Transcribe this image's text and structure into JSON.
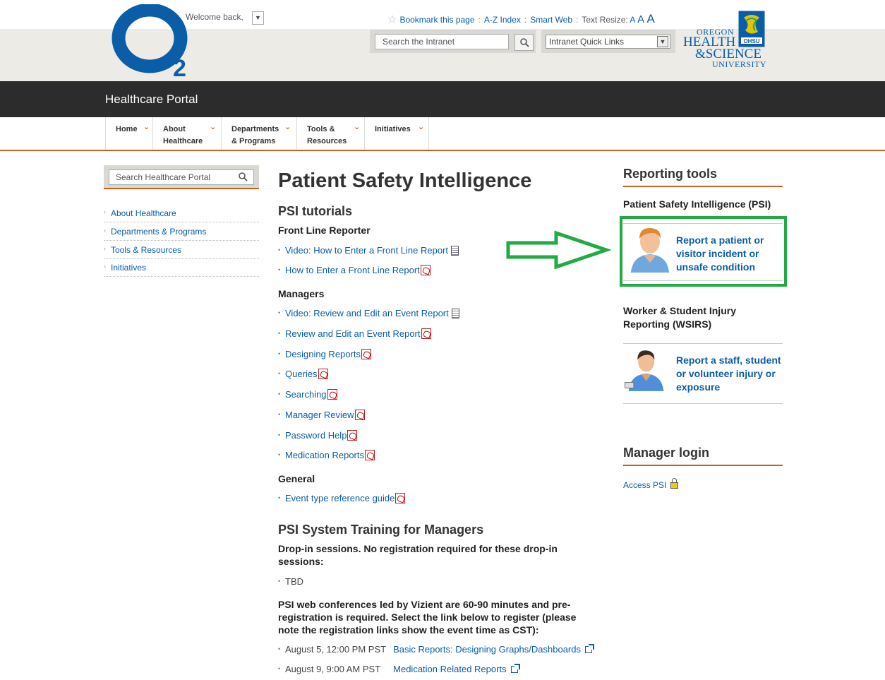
{
  "header": {
    "logo_text": "O",
    "logo_sub": "2",
    "welcome": "Welcome back,",
    "toplinks": {
      "bookmark": "Bookmark this page",
      "az": "A-Z Index",
      "smartweb": "Smart Web",
      "text_resize": "Text Resize:",
      "a_small": "A",
      "a_medium": "A",
      "a_large": "A"
    },
    "search_placeholder": "Search the Intranet",
    "quicklinks": "Intranet Quick Links",
    "ohsu": {
      "line1": "OREGON",
      "line2": "HEALTH",
      "line3": "&SCIENCE",
      "line4": "UNIVERSITY",
      "seal_text": "OHSU"
    }
  },
  "portal_title": "Healthcare Portal",
  "nav": {
    "home": "Home",
    "about_1": "About",
    "about_2": "Healthcare",
    "depts_1": "Departments",
    "depts_2": "& Programs",
    "tools_1": "Tools &",
    "tools_2": "Resources",
    "initiatives": "Initiatives"
  },
  "sidebar": {
    "search_placeholder": "Search Healthcare Portal",
    "items": [
      "About Healthcare",
      "Departments & Programs",
      "Tools & Resources",
      "Initiatives"
    ]
  },
  "main": {
    "title": "Patient Safety Intelligence",
    "tutorials_heading": "PSI tutorials",
    "front_line_heading": "Front Line Reporter",
    "front_line": [
      "Video: How to Enter a Front Line Report",
      "How to Enter a Front Line Report"
    ],
    "managers_heading": "Managers",
    "managers": [
      "Video: Review and Edit an Event Report",
      "Review and Edit an Event Report",
      "Designing Reports",
      "Queries",
      "Searching",
      "Manager Review",
      "Password Help",
      "Medication Reports"
    ],
    "general_heading": "General",
    "general": [
      "Event type reference guide"
    ],
    "training_heading": "PSI System Training for Managers",
    "dropin_text": "Drop-in sessions.  No registration required for these drop-in sessions:",
    "dropin_items": [
      "TBD"
    ],
    "web_conf_text": "PSI web conferences led by Vizient are 60-90 minutes and pre-registration is required.  Select the link below to register (please note the registration links show the event time as CST):",
    "sessions": [
      {
        "date": "August 5, 12:00 PM PST",
        "link": "Basic Reports: Designing Graphs/Dashboards"
      },
      {
        "date": "August 9, 9:00 AM PST",
        "link": "Medication Related Reports"
      }
    ]
  },
  "right": {
    "reporting_title": "Reporting tools",
    "psi_heading": "Patient Safety Intelligence (PSI)",
    "psi_link": [
      "Report a patient or",
      "visitor incident or",
      "unsafe condition"
    ],
    "wsirs_heading": [
      "Worker & Student Injury",
      "Reporting (WSIRS)"
    ],
    "wsirs_link": [
      "Report a staff, student",
      "or volunteer injury or",
      "exposure"
    ],
    "manager_title": "Manager login",
    "access_psi": "Access PSI"
  },
  "colors": {
    "brand_blue": "#0b5da8",
    "accent_orange": "#c8621c",
    "annotation_green": "#22aa44",
    "dark_bar": "#2c2c2c"
  }
}
